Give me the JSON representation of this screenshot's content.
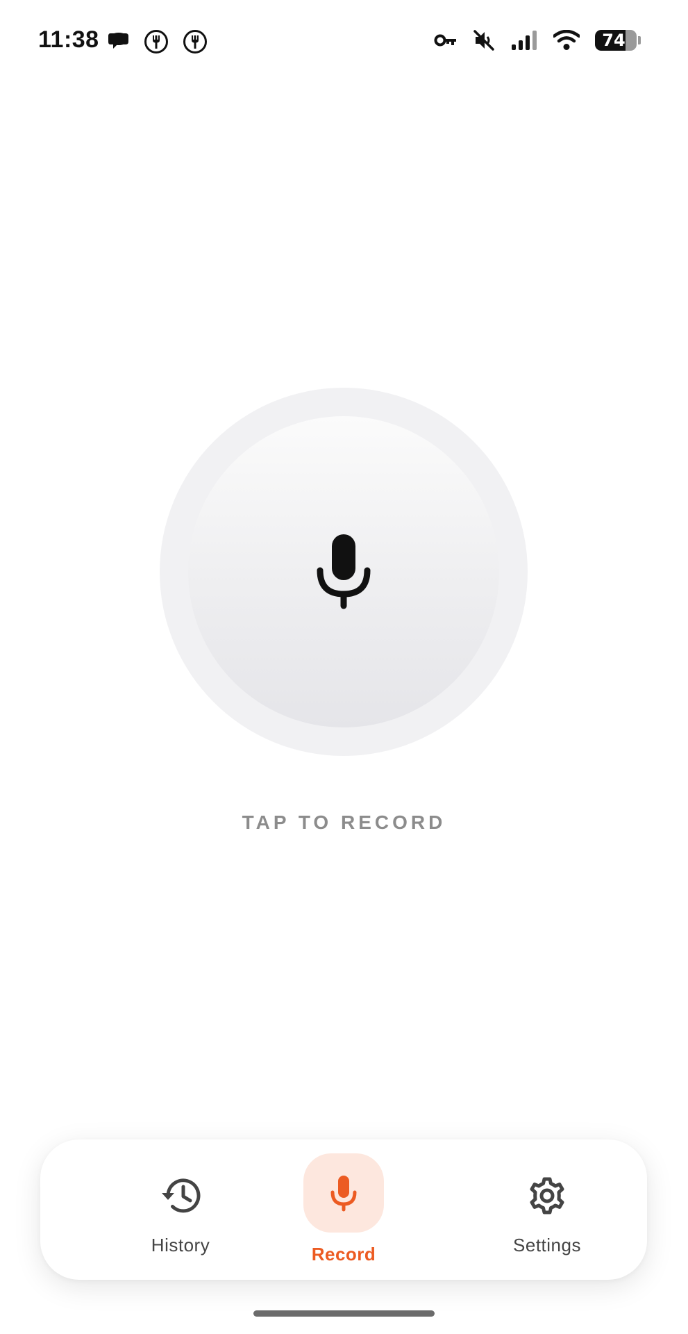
{
  "status_bar": {
    "time": "11:38",
    "battery_level": "74",
    "left_icons": [
      "speech-bubble-icon",
      "fork-circle-icon",
      "fork-circle-icon"
    ],
    "right_icons": [
      "vpn-key-icon",
      "muted-speaker-icon",
      "cellular-signal-icon",
      "wifi-icon",
      "battery-icon"
    ]
  },
  "record_control": {
    "icon": "microphone-icon",
    "label": "TAP TO RECORD"
  },
  "bottom_nav": {
    "items": [
      {
        "label": "History",
        "icon": "history-icon",
        "active": false
      },
      {
        "label": "Record",
        "icon": "microphone-icon",
        "active": true
      },
      {
        "label": "Settings",
        "icon": "gear-icon",
        "active": false
      }
    ]
  },
  "colors": {
    "accent": "#ec5b22",
    "accent_bg": "#fde7de",
    "label_gray": "#8c8c8c"
  }
}
